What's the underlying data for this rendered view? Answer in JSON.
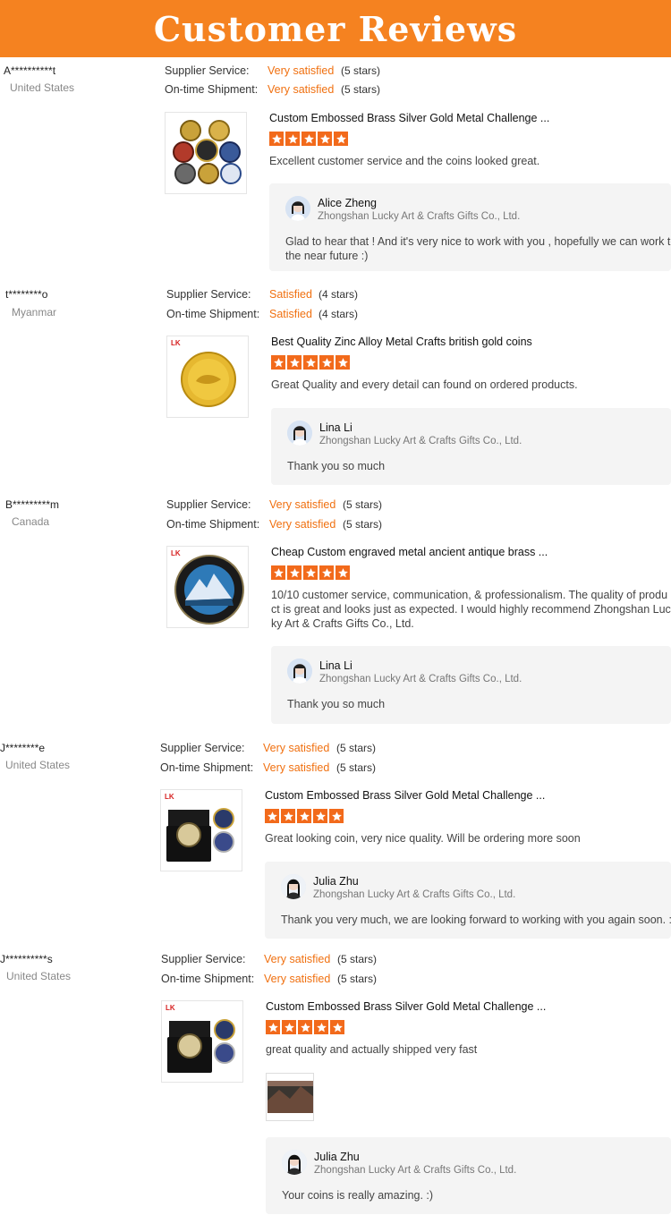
{
  "header": {
    "title": "Customer Reviews"
  },
  "labels": {
    "supplier_service": "Supplier Service:",
    "on_time_shipment": "On-time Shipment:",
    "product_brand_mark": "LK"
  },
  "colors": {
    "accent": "#f58220",
    "star": "#f26a1b",
    "rating_text": "#f07010"
  },
  "reviews": [
    {
      "reviewer": "A**********t",
      "country": "United States",
      "supplier_rating": "Very satisfied",
      "supplier_stars": "(5 stars)",
      "shipment_rating": "Very satisfied",
      "shipment_stars": "(5 stars)",
      "product_title": "Custom Embossed Brass Silver Gold Metal Challenge ...",
      "stars": 5,
      "text_lines": [
        "Excellent customer service and the coins looked great."
      ],
      "reply": {
        "name": "Alice Zheng",
        "company": "Zhongshan Lucky Art & Crafts Gifts Co., Ltd.",
        "text_lines": [
          "Glad to hear that !  And it's very nice to work with you , hopefully we can work together in",
          "the near future :)"
        ]
      }
    },
    {
      "reviewer": "t********o",
      "country": "Myanmar",
      "supplier_rating": "Satisfied",
      "supplier_stars": "(4 stars)",
      "shipment_rating": "Satisfied",
      "shipment_stars": "(4 stars)",
      "product_title": "Best Quality Zinc Alloy Metal Crafts british gold coins",
      "stars": 5,
      "text_lines": [
        "Great Quality and every detail can found on ordered products."
      ],
      "reply": {
        "name": "Lina Li",
        "company": "Zhongshan Lucky Art & Crafts Gifts Co., Ltd.",
        "text_lines": [
          "Thank you so much"
        ]
      }
    },
    {
      "reviewer": "B*********m",
      "country": "Canada",
      "supplier_rating": "Very satisfied",
      "supplier_stars": "(5 stars)",
      "shipment_rating": "Very satisfied",
      "shipment_stars": "(5 stars)",
      "product_title": "Cheap Custom engraved metal ancient antique brass ...",
      "stars": 5,
      "text_lines": [
        "10/10 customer service, communication, & professionalism. The quality of produ",
        "ct is great and looks just as expected. I would highly recommend Zhongshan Luc",
        "ky Art & Crafts Gifts Co., Ltd."
      ],
      "reply": {
        "name": "Lina Li",
        "company": "Zhongshan Lucky Art & Crafts Gifts Co., Ltd.",
        "text_lines": [
          "Thank you so much"
        ]
      }
    },
    {
      "reviewer": "J********e",
      "country": "United States",
      "supplier_rating": "Very satisfied",
      "supplier_stars": "(5 stars)",
      "shipment_rating": "Very satisfied",
      "shipment_stars": "(5 stars)",
      "product_title": "Custom Embossed Brass Silver Gold Metal Challenge ...",
      "stars": 5,
      "text_lines": [
        "Great looking coin, very nice quality.  Will be ordering more soon"
      ],
      "reply": {
        "name": "Julia Zhu",
        "company": "Zhongshan Lucky Art & Crafts Gifts Co., Ltd.",
        "text_lines": [
          "Thank you very much, we are looking forward to working with you again soon. :)"
        ]
      }
    },
    {
      "reviewer": "J**********s",
      "country": "United States",
      "supplier_rating": "Very satisfied",
      "supplier_stars": "(5 stars)",
      "shipment_rating": "Very satisfied",
      "shipment_stars": "(5 stars)",
      "product_title": "Custom Embossed Brass Silver Gold Metal Challenge ...",
      "stars": 5,
      "text_lines": [
        "great quality and actually shipped very fast"
      ],
      "reply": {
        "name": "Julia Zhu",
        "company": "Zhongshan Lucky Art & Crafts Gifts Co., Ltd.",
        "text_lines": [
          "Your coins is really amazing. :)"
        ]
      }
    }
  ]
}
